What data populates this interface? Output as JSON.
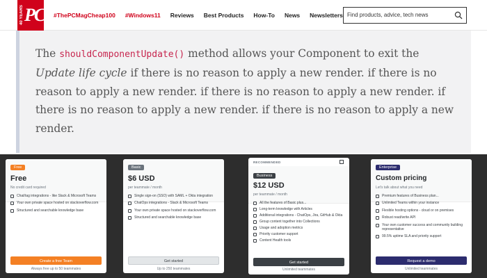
{
  "header": {
    "logo_years": "40 YEARS",
    "logo_mark": "PC",
    "nav": [
      {
        "label": "#ThePCMagCheap100",
        "hot": true
      },
      {
        "label": "#Windows11",
        "hot": true
      },
      {
        "label": "Reviews",
        "hot": false
      },
      {
        "label": "Best Products",
        "hot": false
      },
      {
        "label": "How-To",
        "hot": false
      },
      {
        "label": "News",
        "hot": false
      },
      {
        "label": "Newsletters",
        "hot": false
      }
    ],
    "search_placeholder": "Find products, advice, tech news"
  },
  "quote": {
    "prefix": "The ",
    "code": "shouldComponentUpdate()",
    "mid": " method allows your Component to exit the ",
    "emphasis": "Update life cycle",
    "suffix": " if there is no reason to apply a new render. if there is no reason to apply a new render. if there is no reason to apply a new render. if there is no reason to apply a new render. if there is no reason to apply a new render."
  },
  "pricing": {
    "colors": {
      "free": "#f48024",
      "basic": "#e3e6e8",
      "business": "#3b4045",
      "enterprise": "#2c2c6e"
    },
    "plans": [
      {
        "id": "free",
        "badge": "Free",
        "price": "Free",
        "sub": "No credit card required",
        "features": [
          "Chat/tag integrations - like Slack & Microsoft Teams",
          "Your own private space hosted on stackoverflow.com",
          "Structured and searchable knowledge base"
        ],
        "button": "Create a free Team",
        "foot": "Always free up to 50 teammates"
      },
      {
        "id": "basic",
        "badge": "Basic",
        "price": "$6 USD",
        "sub": "per teammate / month",
        "features": [
          "Single sign-on (SSO) with SAML + Okta integration",
          "ChatOps integrations - Slack & Microsoft Teams",
          "Your own private space hosted on stackoverflow.com",
          "Structured and searchable knowledge base"
        ],
        "button": "Get started",
        "foot": "Up to 250 teammates"
      },
      {
        "id": "business",
        "recommended": "RECOMMENDED",
        "badge": "Business",
        "price": "$12 USD",
        "sub": "per teammate / month",
        "features": [
          "All the features of Basic plus...",
          "Long-term knowledge with Articles",
          "Additional integrations - ChatOps, Jira, GitHub & Okta",
          "Group content together into Collections",
          "Usage and adoption metrics",
          "Priority customer support",
          "Content Health tools"
        ],
        "button": "Get started",
        "foot": "Unlimited teammates"
      },
      {
        "id": "enterprise",
        "badge": "Enterprise",
        "price": "Custom pricing",
        "sub": "Let's talk about what you need",
        "features": [
          "Premium features of Business plan...",
          "Unlimited Teams within your instance",
          "Flexible hosting options - cloud or on premises",
          "Robust read/write API",
          "Your own customer success and community building representative",
          "99.5% uptime SLA and priority support"
        ],
        "button": "Request a demo",
        "foot": "Unlimited teammates"
      }
    ]
  }
}
